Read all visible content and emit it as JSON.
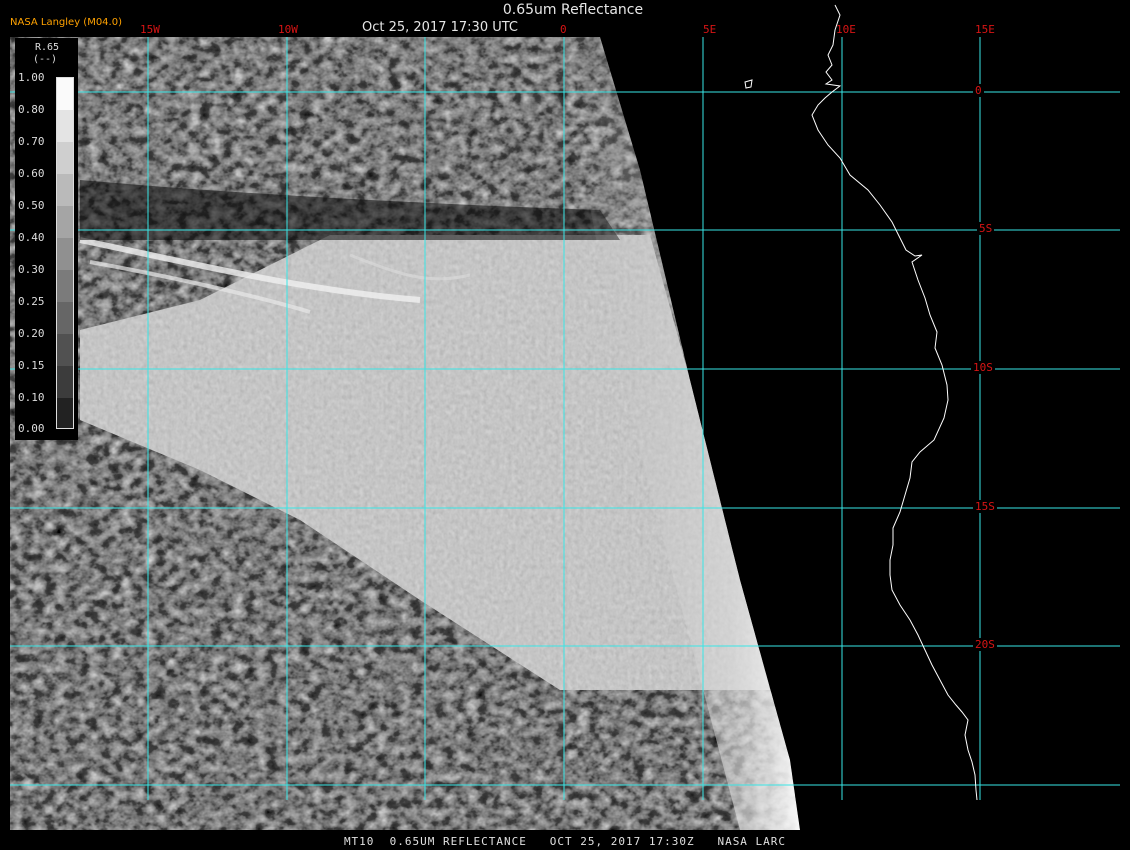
{
  "header": {
    "title": "0.65um Reflectance",
    "datetime": "Oct 25, 2017 17:30 UTC",
    "org": "NASA Langley (M04.0)"
  },
  "footer": {
    "text": "MT10  0.65UM REFLECTANCE   OCT 25, 2017 17:30Z   NASA LARC"
  },
  "map": {
    "longitude_labels": [
      "15W",
      "10W",
      "0",
      "5E",
      "10E",
      "15E"
    ],
    "latitude_labels": [
      "0",
      "5S",
      "10S",
      "15S",
      "20S"
    ],
    "grid_color": "#39e6e6",
    "label_color": "#d81414",
    "coastline_color": "#ffffff"
  },
  "legend": {
    "title": "R.65",
    "units": "(--)",
    "ticks": [
      "1.00",
      "0.80",
      "0.70",
      "0.60",
      "0.50",
      "0.40",
      "0.30",
      "0.25",
      "0.20",
      "0.15",
      "0.10",
      "0.00"
    ]
  }
}
